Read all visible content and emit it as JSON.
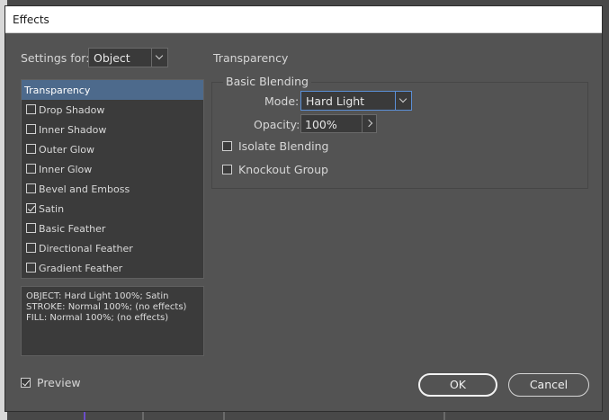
{
  "dialog": {
    "title": "Effects"
  },
  "settings_for": {
    "label": "Settings for:",
    "value": "Object"
  },
  "effects_list": [
    {
      "label": "Transparency",
      "checked": null,
      "selected": true
    },
    {
      "label": "Drop Shadow",
      "checked": false
    },
    {
      "label": "Inner Shadow",
      "checked": false
    },
    {
      "label": "Outer Glow",
      "checked": false
    },
    {
      "label": "Inner Glow",
      "checked": false
    },
    {
      "label": "Bevel and Emboss",
      "checked": false
    },
    {
      "label": "Satin",
      "checked": true
    },
    {
      "label": "Basic Feather",
      "checked": false
    },
    {
      "label": "Directional Feather",
      "checked": false
    },
    {
      "label": "Gradient Feather",
      "checked": false
    }
  ],
  "summary": [
    "OBJECT: Hard Light 100%; Satin",
    "STROKE: Normal 100%; (no effects)",
    "FILL: Normal 100%; (no effects)"
  ],
  "panel": {
    "heading": "Transparency",
    "group_title": "Basic Blending",
    "mode_label": "Mode:",
    "mode_value": "Hard Light",
    "opacity_label": "Opacity:",
    "opacity_value": "100%",
    "isolate_label": "Isolate Blending",
    "knockout_label": "Knockout Group"
  },
  "preview": {
    "label": "Preview",
    "checked": true
  },
  "buttons": {
    "ok": "OK",
    "cancel": "Cancel"
  },
  "colors": {
    "accent": "#4d6a8c",
    "dialog_bg": "#535353",
    "field_bg": "#3a3a3a"
  }
}
